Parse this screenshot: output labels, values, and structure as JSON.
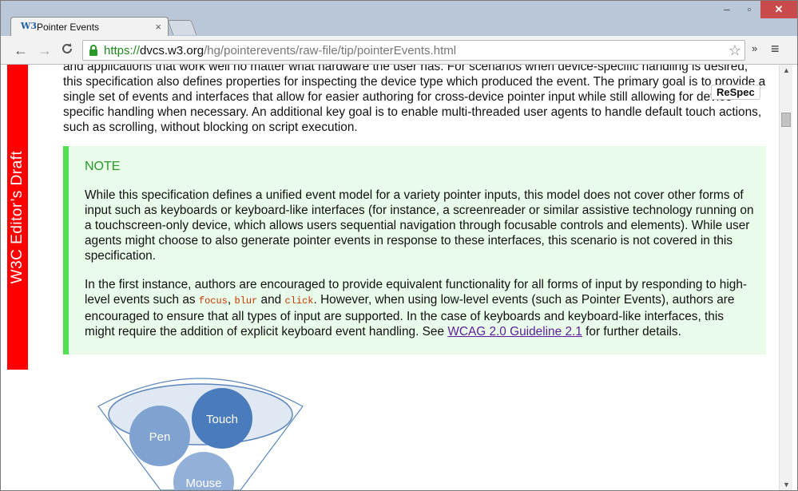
{
  "browser": {
    "tab_title": "Pointer Events",
    "favicon_text": "W3",
    "tab_close": "×",
    "window_controls": {
      "minimize": "–",
      "maximize": "▫",
      "close": "✕"
    },
    "nav": {
      "back": "←",
      "forward": "→",
      "reload": "C"
    },
    "url": {
      "scheme": "https://",
      "host": "dvcs.w3.org",
      "path": "/hg/pointerevents/raw-file/tip/pointerEvents.html"
    },
    "star_icon": "☆",
    "extensions": "»",
    "menu": "≡",
    "scroll_up": "▲",
    "scroll_down": "▼"
  },
  "page": {
    "side_banner": "W3C Editor’s Draft",
    "respec_label": "ReSpec",
    "intro_text": "and applications that work well no matter what hardware the user has. For scenarios when device-specific handling is desired, this specification also defines properties for inspecting the device type which produced the event. The primary goal is to provide a single set of events and interfaces that allow for easier authoring for cross-device pointer input while still allowing for device-specific handling when necessary. An additional key goal is to enable multi-threaded user agents to handle default touch actions, such as scrolling, without blocking on script execution.",
    "note": {
      "title": "NOTE",
      "p1": "While this specification defines a unified event model for a variety pointer inputs, this model does not cover other forms of input such as keyboards or keyboard-like interfaces (for instance, a screenreader or similar assistive technology running on a touchscreen-only device, which allows users sequential navigation through focusable controls and elements). While user agents might choose to also generate pointer events in response to these interfaces, this scenario is not covered in this specification.",
      "p2_a": "In the first instance, authors are encouraged to provide equivalent functionality for all forms of input by responding to high-level events such as ",
      "code_focus": "focus",
      "p2_sep1": ", ",
      "code_blur": "blur",
      "p2_sep2": " and ",
      "code_click": "click",
      "p2_b": ". However, when using low-level events (such as Pointer Events), authors are encouraged to ensure that all types of input are supported. In the case of keyboards and keyboard-like interfaces, this might require the addition of explicit keyboard event handling. See ",
      "link": "WCAG 2.0 Guideline 2.1",
      "p2_c": " for further details."
    },
    "diagram": {
      "pen": "Pen",
      "touch": "Touch",
      "mouse": "Mouse"
    }
  },
  "colors": {
    "banner": "#ff0000",
    "note_border": "#52e052",
    "note_bg": "#e9fbe9",
    "note_title": "#2b9a2b",
    "url_scheme": "#1e8a1e",
    "link": "#5a1e9e"
  }
}
